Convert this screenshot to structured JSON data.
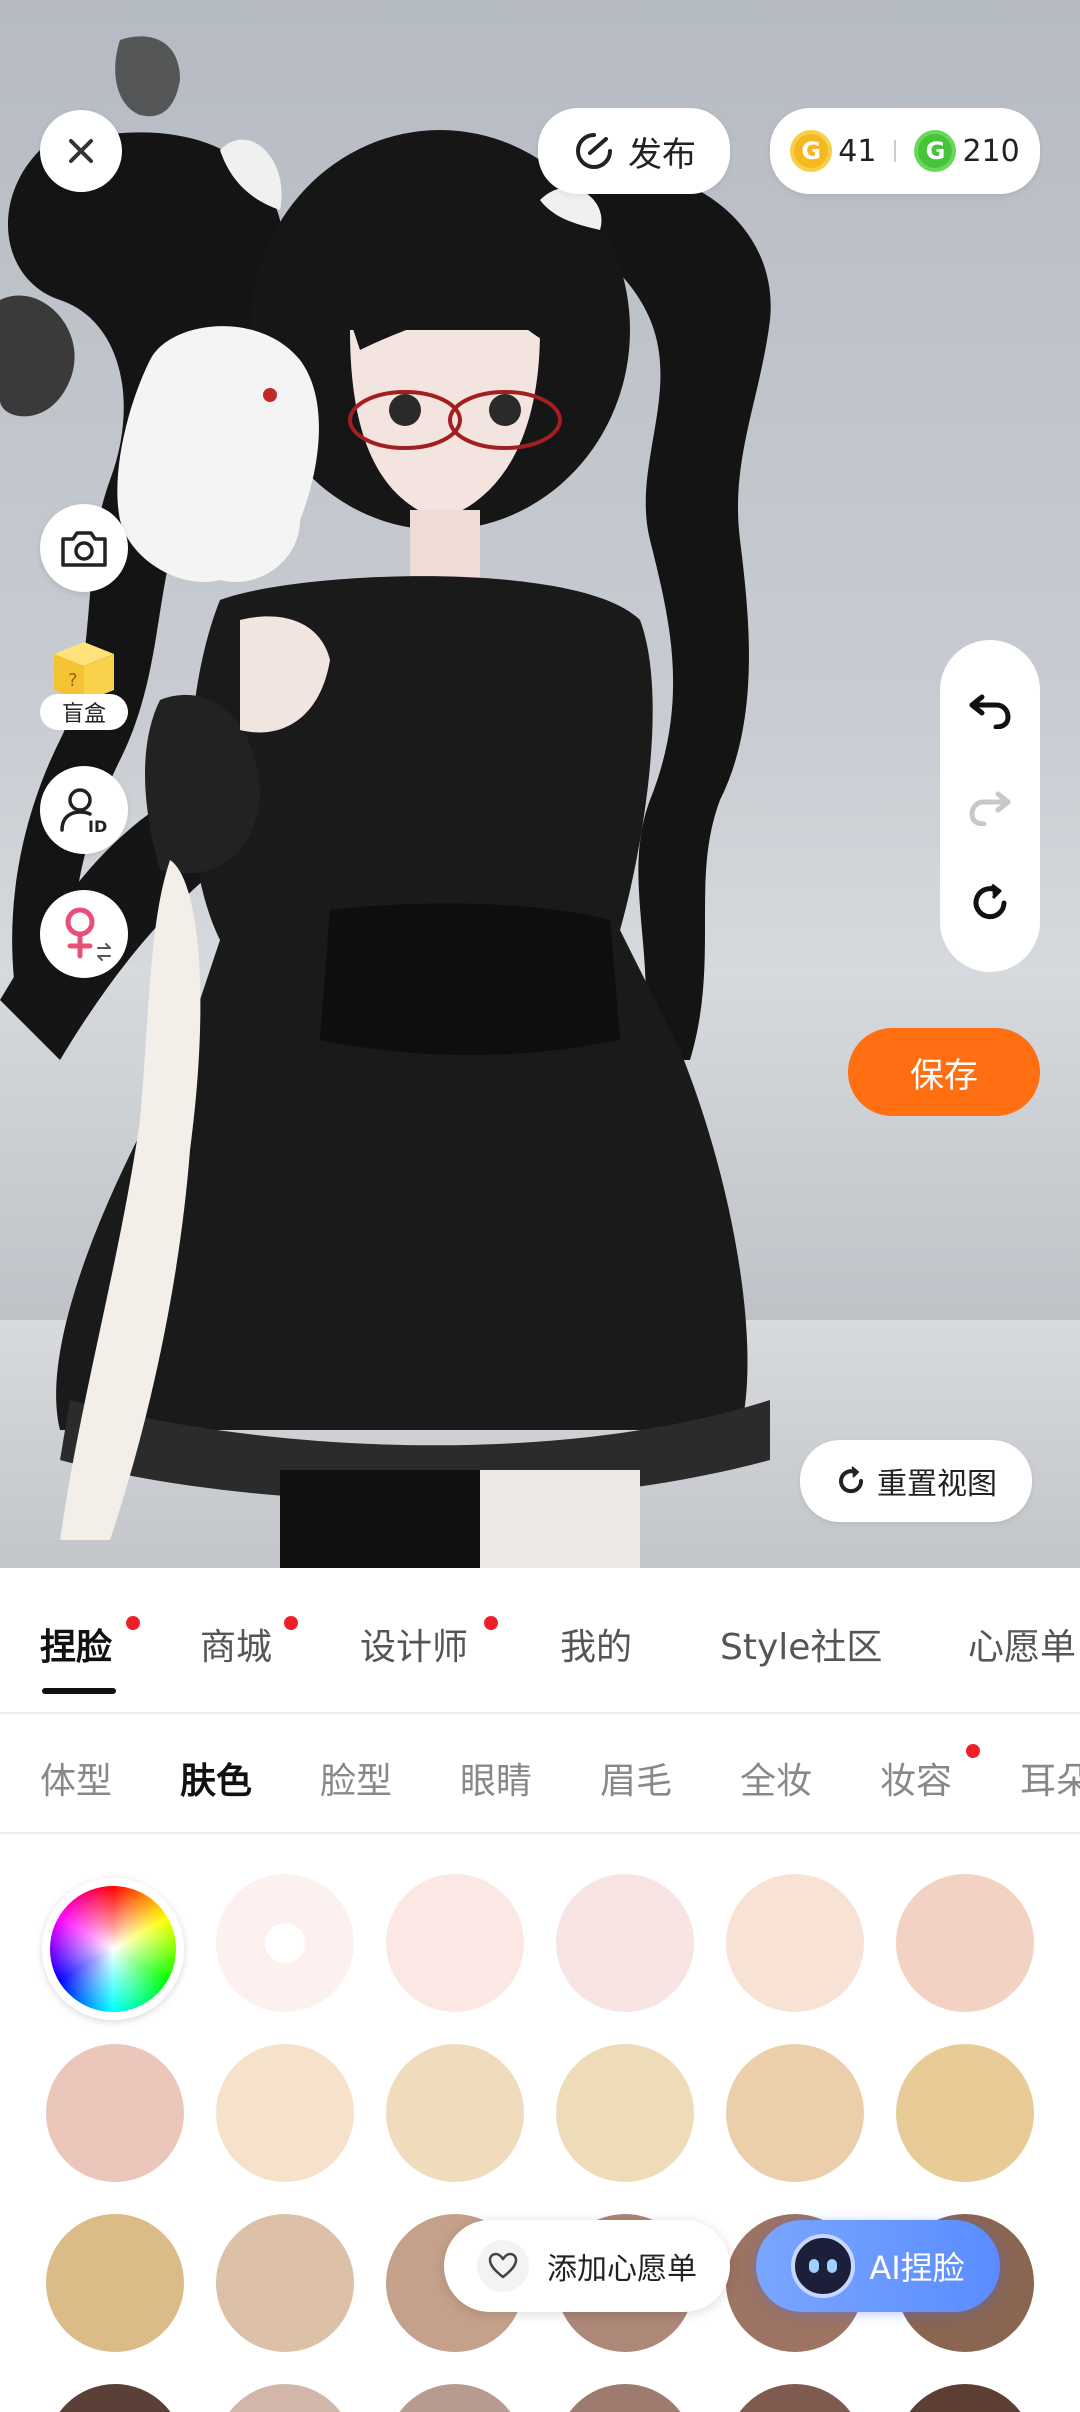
{
  "topbar": {
    "publish_label": "发布",
    "gold_coins": "41",
    "green_coins": "210"
  },
  "left_tools": {
    "blind_box_label": "盲盒"
  },
  "save_label": "保存",
  "reset_view_label": "重置视图",
  "main_tabs": [
    {
      "label": "捏脸",
      "active": true,
      "dot": true
    },
    {
      "label": "商城",
      "active": false,
      "dot": true
    },
    {
      "label": "设计师",
      "active": false,
      "dot": true
    },
    {
      "label": "我的",
      "active": false,
      "dot": false
    },
    {
      "label": "Style社区",
      "active": false,
      "dot": false
    },
    {
      "label": "心愿单",
      "active": false,
      "dot": false
    }
  ],
  "sub_tabs": [
    {
      "label": "体型",
      "active": false
    },
    {
      "label": "肤色",
      "active": true
    },
    {
      "label": "脸型",
      "active": false
    },
    {
      "label": "眼睛",
      "active": false
    },
    {
      "label": "眉毛",
      "active": false
    },
    {
      "label": "全妆",
      "active": false
    },
    {
      "label": "妆容",
      "active": false,
      "dot": true
    },
    {
      "label": "耳朵",
      "active": false
    }
  ],
  "skin_swatches": [
    [
      "#fdf1ef",
      "#fbe8e4",
      "#f8e4e2",
      "#f8e2d5",
      "#f3d2c4"
    ],
    [
      "#ebc6bb",
      "#f6e2cb",
      "#f1dbbd",
      "#eedbb7",
      "#ebcfaa",
      "#e9cb97"
    ],
    [
      "#dbbb87",
      "#dcc0a7",
      "#c5a18b",
      "#ad8777",
      "#9d7363",
      "#8a6552"
    ],
    [
      "#5a4036",
      "#d2b6a9",
      "#b89b8f",
      "#9f7a6e",
      "#7f5a4e",
      "#5c3e34"
    ]
  ],
  "selected_swatch": "#fdf1ef",
  "wishlist_label": "添加心愿单",
  "ai_face_label": "AI捏脸",
  "colors": {
    "accent_orange": "#ff6f12",
    "badge_red": "#f0202a",
    "ai_blue": "#5a8cff"
  },
  "icons": [
    "close-icon",
    "publish-icon",
    "gold-coin-icon",
    "green-coin-icon",
    "camera-icon",
    "blind-box-icon",
    "profile-id-icon",
    "female-gender-icon",
    "undo-icon",
    "redo-icon",
    "refresh-icon",
    "reset-view-icon",
    "color-wheel-icon",
    "heart-icon",
    "ai-robot-icon"
  ]
}
